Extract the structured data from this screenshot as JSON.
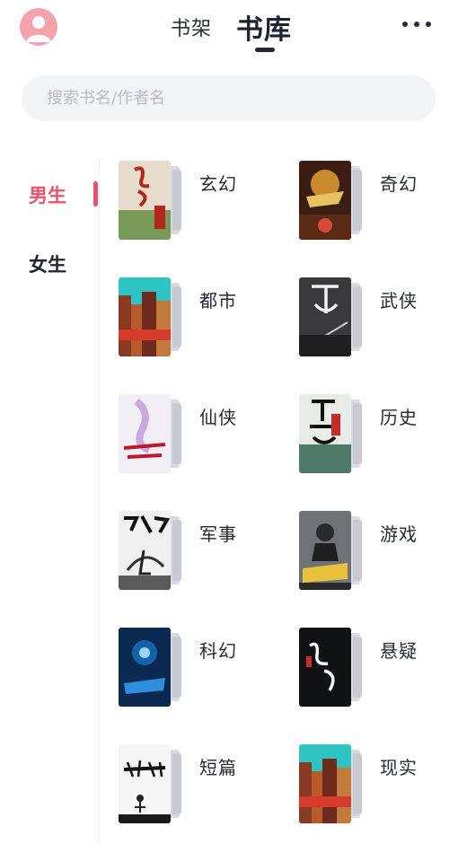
{
  "header": {
    "tab_bookshelf": "书架",
    "tab_library": "书库"
  },
  "search": {
    "placeholder": "搜索书名/作者名"
  },
  "sidebar": {
    "items": [
      {
        "label": "男生",
        "active": true
      },
      {
        "label": "女生",
        "active": false
      }
    ]
  },
  "categories": [
    {
      "label": "玄幻"
    },
    {
      "label": "奇幻"
    },
    {
      "label": "都市"
    },
    {
      "label": "武侠"
    },
    {
      "label": "仙侠"
    },
    {
      "label": "历史"
    },
    {
      "label": "军事"
    },
    {
      "label": "游戏"
    },
    {
      "label": "科幻"
    },
    {
      "label": "悬疑"
    },
    {
      "label": "短篇"
    },
    {
      "label": "现实"
    }
  ],
  "colors": {
    "accent": "#ee4f6a",
    "avatar": "#f4a3ad",
    "search_bg": "#f3f4f8"
  }
}
